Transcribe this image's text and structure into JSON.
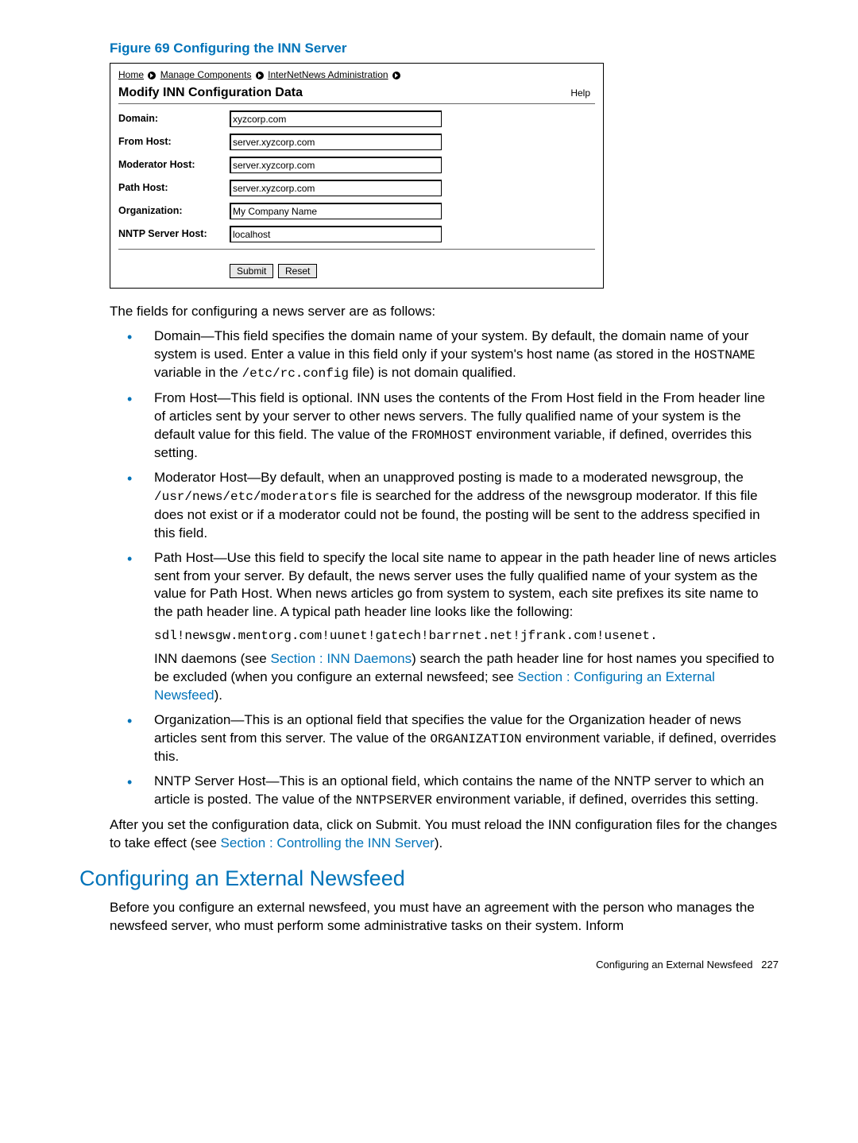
{
  "figure": {
    "caption": "Figure 69 Configuring the INN Server"
  },
  "screenshot": {
    "breadcrumb": {
      "home": "Home",
      "manage": "Manage Components",
      "inn": "InterNetNews Administration"
    },
    "title": "Modify INN Configuration Data",
    "help": "Help",
    "fields": {
      "domain": {
        "label": "Domain:",
        "value": "xyzcorp.com"
      },
      "from_host": {
        "label": "From Host:",
        "value": "server.xyzcorp.com"
      },
      "moderator_host": {
        "label": "Moderator Host:",
        "value": "server.xyzcorp.com"
      },
      "path_host": {
        "label": "Path Host:",
        "value": "server.xyzcorp.com"
      },
      "organization": {
        "label": "Organization:",
        "value": "My Company Name"
      },
      "nntp": {
        "label": "NNTP Server Host:",
        "value": "localhost"
      }
    },
    "buttons": {
      "submit": "Submit",
      "reset": "Reset"
    }
  },
  "intro": "The fields for configuring a news server are as follows:",
  "items": {
    "domain": {
      "a": "Domain—This field specifies the domain name of your system. By default, the domain name of your system is used. Enter a value in this field only if your system's host name (as stored in the ",
      "code1": "HOSTNAME",
      "b": " variable in the ",
      "code2": "/etc/rc.config",
      "c": " file) is not domain qualified."
    },
    "fromhost": {
      "a": "From Host—This field is optional. INN uses the contents of the From Host field in the From header line of articles sent by your server to other news servers. The fully qualified name of your system is the default value for this field. The value of the ",
      "code1": "FROMHOST",
      "b": " environment variable, if defined, overrides this setting."
    },
    "moderator": {
      "a": "Moderator Host—By default, when an unapproved posting is made to a moderated newsgroup, the ",
      "code1": "/usr/news/etc/moderators",
      "b": " file is searched for the address of the newsgroup moderator. If this file does not exist or if a moderator could not be found, the posting will be sent to the address specified in this field."
    },
    "pathhost": {
      "a": "Path Host—Use this field to specify the local site name to appear in the path header line of news articles sent from your server. By default, the news server uses the fully qualified name of your system as the value for Path Host. When news articles go from system to system, each site prefixes its site name to the path header line. A typical path header line looks like the following:"
    },
    "path_example": "sdl!newsgw.mentorg.com!uunet!gatech!barrnet.net!jfrank.com!usenet.",
    "path_note": {
      "a": "INN daemons (see ",
      "link1": "Section : INN Daemons",
      "b": ") search the path header line for host names you specified to be excluded (when you configure an external newsfeed; see ",
      "link2": "Section : Configuring an External Newsfeed",
      "c": ")."
    },
    "organization": {
      "a": "Organization—This is an optional field that specifies the value for the Organization header of news articles sent from this server. The value of the ",
      "code1": "ORGANIZATION",
      "b": " environment variable, if defined, overrides this."
    },
    "nntp": {
      "a": "NNTP Server Host—This is an optional field, which contains the name of the NNTP server to which an article is posted. The value of the ",
      "code1": "NNTPSERVER",
      "b": " environment variable, if defined, overrides this setting."
    }
  },
  "outro": {
    "a": "After you set the configuration data, click on Submit. You must reload the INN configuration files for the changes to take effect (see ",
    "link": "Section : Controlling the INN Server",
    "b": ")."
  },
  "section_heading": "Configuring an External Newsfeed",
  "section_body": "Before you configure an external newsfeed, you must have an agreement with the person who manages the newsfeed server, who must perform some administrative tasks on their system. Inform",
  "footer": {
    "text": "Configuring an External Newsfeed",
    "page": "227"
  }
}
